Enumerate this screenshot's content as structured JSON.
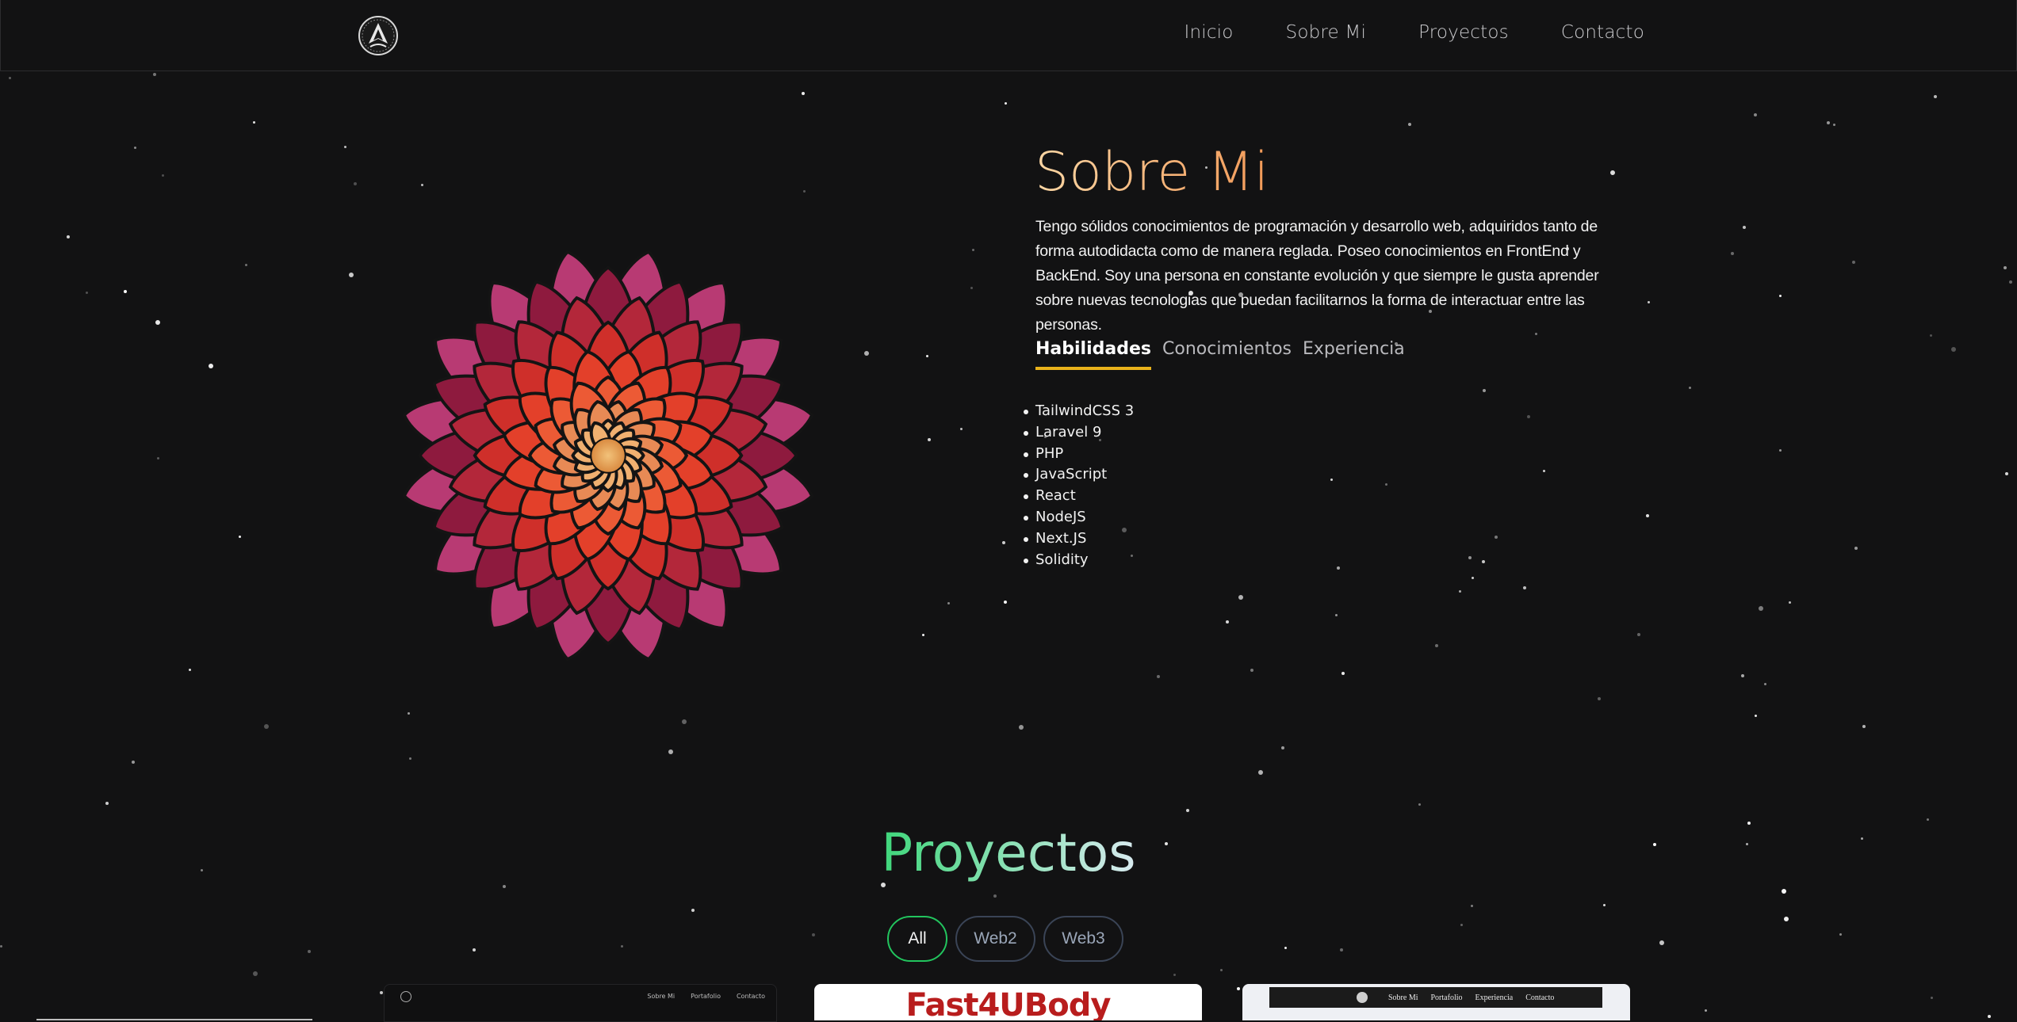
{
  "nav": {
    "links": [
      "Inicio",
      "Sobre Mi",
      "Proyectos",
      "Contacto"
    ]
  },
  "about": {
    "title": "Sobre Mi",
    "text": "Tengo sólidos conocimientos de programación y desarrollo web, adquiridos tanto de forma autodidacta como de manera reglada. Poseo conocimientos en FrontEnd y BackEnd. Soy una persona en constante evolución y que siempre le gusta aprender sobre nuevas tecnologias que puedan facilitarnos la forma de interactuar entre las personas.",
    "tabs": [
      "Habilidades",
      "Conocimientos",
      "Experiencia"
    ],
    "active_tab": "Habilidades",
    "skills": [
      "TailwindCSS 3",
      "Laravel 9",
      "PHP",
      "JavaScript",
      "React",
      "NodeJS",
      "Next.JS",
      "Solidity"
    ]
  },
  "projects": {
    "title": "Proyectos",
    "filters": [
      "All",
      "Web2",
      "Web3"
    ],
    "active_filter": "All",
    "cards": [
      {
        "nav": [
          "Sobre Mi",
          "Portafolio",
          "Contacto"
        ]
      },
      {
        "title": "Fast4UBody"
      },
      {
        "nav": [
          "Sobre Mi",
          "Portafolio",
          "Experiencia",
          "Contacto"
        ]
      }
    ]
  },
  "colors": {
    "background": "#121213",
    "about_gradient_start": "#fbd6a4",
    "about_gradient_end": "#f29a58",
    "tab_underline": "#e9b21b",
    "projects_gradient_start": "#3ed67a",
    "filter_active_border": "#22c55e"
  },
  "icons": {
    "logo": "tree-of-life-logo",
    "hero_image": "mandala-flower"
  }
}
